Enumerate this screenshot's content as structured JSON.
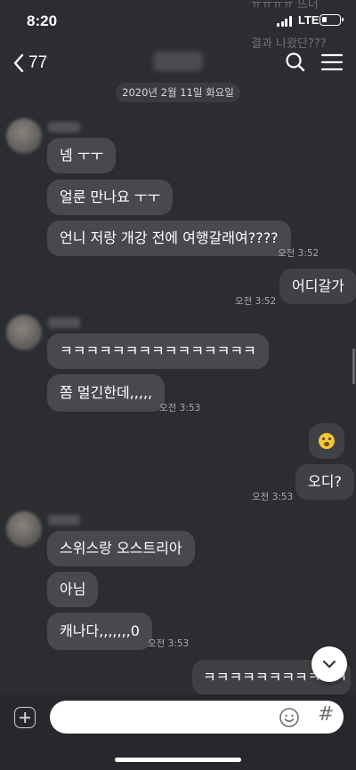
{
  "status_bar": {
    "time": "8:20",
    "network": "LTE",
    "background_text_1": "ㅠㅠㅠㅠ 뜨더",
    "background_text_2": "결과 나왔단???"
  },
  "header": {
    "unread_count": "77",
    "icons": [
      "chevron-left-icon",
      "search-icon",
      "menu-icon"
    ]
  },
  "date_divider": "2020년 2월 11일 화요일",
  "messages": [
    {
      "side": "left",
      "text": "넴 ㅜㅜ"
    },
    {
      "side": "left",
      "text": "얼룬 만나요 ㅜㅜ"
    },
    {
      "side": "left",
      "text": "언니 저랑 개강 전에 여행갈래여????",
      "time": "오전 3:52"
    },
    {
      "side": "right",
      "text": "어디갈가",
      "time": "오전 3:52"
    },
    {
      "side": "left",
      "text": "ㅋㅋㅋㅋㅋㅋㅋㅋㅋㅋㅋㅋㅋㅋㅋ"
    },
    {
      "side": "left",
      "text": "쫌 멀긴한데,,,,,",
      "time": "오전 3:53"
    },
    {
      "side": "right",
      "emoji": "shushing-face-emoji"
    },
    {
      "side": "right",
      "text": "오디?",
      "time": "오전 3:53"
    },
    {
      "side": "left",
      "text": "스위스랑 오스트리아"
    },
    {
      "side": "left",
      "text": "아님"
    },
    {
      "side": "left",
      "text": "캐나다,,,,,,,0",
      "time": "오전 3:53"
    },
    {
      "side": "right",
      "text": "ㅋㅋㅋㅋㅋㅋㅋㅋㅋㅋㅋ"
    }
  ],
  "input": {
    "value": "",
    "icons": [
      "plus-icon",
      "emoji-icon",
      "hash-icon"
    ],
    "hash_label": "#"
  },
  "colors": {
    "background": "#2b2d31",
    "bubble_other": "#48494e",
    "bubble_me": "#404145",
    "input_bar": "#26282c"
  }
}
